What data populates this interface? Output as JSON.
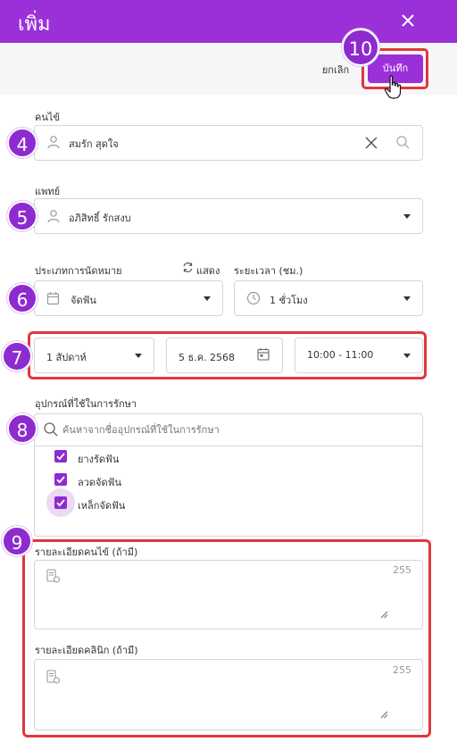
{
  "header": {
    "title": "เพิ่ม"
  },
  "toolbar": {
    "cancel_label": "ยกเลิก",
    "save_label": "บันทึก"
  },
  "steps": {
    "save": "10",
    "patient": "4",
    "doctor": "5",
    "type": "6",
    "schedule": "7",
    "equipment": "8",
    "details": "9"
  },
  "patient": {
    "label": "คนไข้",
    "value": "สมรัก สุดใจ"
  },
  "doctor": {
    "label": "แพทย์",
    "value": "อภิสิทธิ์ รักสงบ"
  },
  "appointment": {
    "type_label": "ประเภทการนัดหมาย",
    "show_label": "แสดง",
    "type_value": "จัดฟัน",
    "duration_label": "ระยะเวลา (ชม.)",
    "duration_value": "1 ชั่วโมง"
  },
  "schedule": {
    "repeat_value": "1 สัปดาห์",
    "date_value": "5 ธ.ค. 2568",
    "time_value": "10:00 - 11:00"
  },
  "equipment": {
    "label": "อุปกรณ์ที่ใช้ในการรักษา",
    "search_placeholder": "ค้นหาจากชื่ออุปกรณ์ที่ใช้ในการรักษา",
    "items": [
      {
        "label": "ยางรัดฟัน",
        "checked": true
      },
      {
        "label": "ลวดจัดฟัน",
        "checked": true
      },
      {
        "label": "เหล็กจัดฟัน",
        "checked": true
      }
    ]
  },
  "patient_details": {
    "label": "รายละเอียดคนไข้ (ถ้ามี)",
    "counter": "255"
  },
  "clinic_details": {
    "label": "รายละเอียดคลินิก (ถ้ามี)",
    "counter": "255"
  },
  "colors": {
    "brand": "#9b30d9",
    "highlight": "#e2363c"
  }
}
